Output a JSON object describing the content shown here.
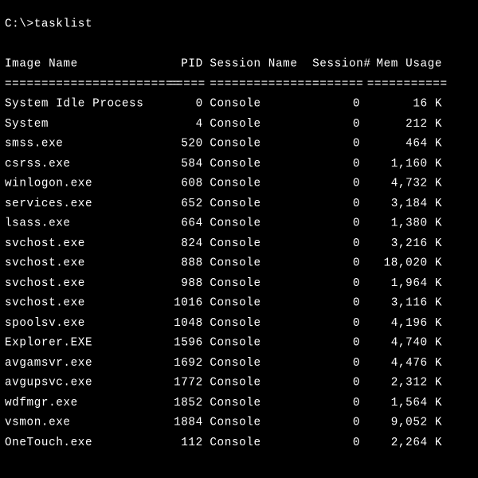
{
  "prompt": "C:\\>tasklist",
  "headers": {
    "image_name": "Image Name",
    "pid": "PID",
    "session_name": "Session Name",
    "session_num": "Session#",
    "mem_usage": "Mem Usage"
  },
  "separators": {
    "image_name": "========================",
    "pid": "=====",
    "session_name": "===============",
    "session_num": "=======",
    "mem_usage": "==========="
  },
  "processes": [
    {
      "image_name": "System Idle Process",
      "pid": "0",
      "session_name": "Console",
      "session_num": "0",
      "mem_usage": "16 K"
    },
    {
      "image_name": "System",
      "pid": "4",
      "session_name": "Console",
      "session_num": "0",
      "mem_usage": "212 K"
    },
    {
      "image_name": "smss.exe",
      "pid": "520",
      "session_name": "Console",
      "session_num": "0",
      "mem_usage": "464 K"
    },
    {
      "image_name": "csrss.exe",
      "pid": "584",
      "session_name": "Console",
      "session_num": "0",
      "mem_usage": "1,160 K"
    },
    {
      "image_name": "winlogon.exe",
      "pid": "608",
      "session_name": "Console",
      "session_num": "0",
      "mem_usage": "4,732 K"
    },
    {
      "image_name": "services.exe",
      "pid": "652",
      "session_name": "Console",
      "session_num": "0",
      "mem_usage": "3,184 K"
    },
    {
      "image_name": "lsass.exe",
      "pid": "664",
      "session_name": "Console",
      "session_num": "0",
      "mem_usage": "1,380 K"
    },
    {
      "image_name": "svchost.exe",
      "pid": "824",
      "session_name": "Console",
      "session_num": "0",
      "mem_usage": "3,216 K"
    },
    {
      "image_name": "svchost.exe",
      "pid": "888",
      "session_name": "Console",
      "session_num": "0",
      "mem_usage": "18,020 K"
    },
    {
      "image_name": "svchost.exe",
      "pid": "988",
      "session_name": "Console",
      "session_num": "0",
      "mem_usage": "1,964 K"
    },
    {
      "image_name": "svchost.exe",
      "pid": "1016",
      "session_name": "Console",
      "session_num": "0",
      "mem_usage": "3,116 K"
    },
    {
      "image_name": "spoolsv.exe",
      "pid": "1048",
      "session_name": "Console",
      "session_num": "0",
      "mem_usage": "4,196 K"
    },
    {
      "image_name": "Explorer.EXE",
      "pid": "1596",
      "session_name": "Console",
      "session_num": "0",
      "mem_usage": "4,740 K"
    },
    {
      "image_name": "avgamsvr.exe",
      "pid": "1692",
      "session_name": "Console",
      "session_num": "0",
      "mem_usage": "4,476 K"
    },
    {
      "image_name": "avgupsvc.exe",
      "pid": "1772",
      "session_name": "Console",
      "session_num": "0",
      "mem_usage": "2,312 K"
    },
    {
      "image_name": "wdfmgr.exe",
      "pid": "1852",
      "session_name": "Console",
      "session_num": "0",
      "mem_usage": "1,564 K"
    },
    {
      "image_name": "vsmon.exe",
      "pid": "1884",
      "session_name": "Console",
      "session_num": "0",
      "mem_usage": "9,052 K"
    },
    {
      "image_name": "OneTouch.exe",
      "pid": "112",
      "session_name": "Console",
      "session_num": "0",
      "mem_usage": "2,264 K"
    }
  ]
}
